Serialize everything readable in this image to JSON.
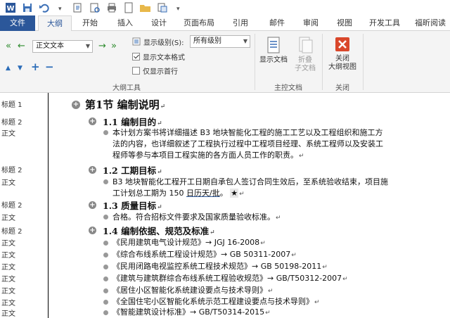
{
  "quick_access": {
    "icons": [
      "word-logo-icon",
      "save-icon",
      "undo-icon",
      "redo-icon",
      "open-icon",
      "print-preview-icon",
      "print-icon",
      "new-document-icon",
      "folder-icon",
      "format-icon"
    ]
  },
  "tabs": [
    "文件",
    "大纲",
    "开始",
    "插入",
    "设计",
    "页面布局",
    "引用",
    "邮件",
    "审阅",
    "视图",
    "开发工具",
    "福昕阅读"
  ],
  "ribbon": {
    "outline_tools": {
      "level_combo": "正文文本",
      "show_level_label": "显示级别(S):",
      "show_level_value": "所有级别",
      "show_text_format": "显示文本格式",
      "show_first_line": "仅显示首行",
      "group_label": "大纲工具"
    },
    "master_doc": {
      "show_doc": "显示文档",
      "collapse_sub_1": "折叠",
      "collapse_sub_2": "子文档",
      "group_label": "主控文档"
    },
    "close": {
      "close_1": "关闭",
      "close_2": "大纲视图",
      "group_label": "关闭"
    },
    "colors": {
      "close_red": "#d9472b",
      "accent": "#2b579a"
    }
  },
  "outline": {
    "styles": [
      "标题 1",
      "标题 2",
      "正文",
      "标题 2",
      "正文",
      "标题 2",
      "正文",
      "标题 2",
      "正文",
      "正文",
      "正文",
      "正文",
      "正文",
      "正文",
      "正文",
      "正文"
    ],
    "h1": "第1节 编制说明",
    "s1_title": "1.1 编制目的",
    "s1_body_1": "本计划方案书将详细描述 B3 地块智能化工程的施工工艺以及工程组织和施工方",
    "s1_body_2": "法的内容，也详细叙述了工程执行过程中工程项目经理、系统工程师以及安装工",
    "s1_body_3": "程师等参与本项目工程实施的各方面人员工作的职责。",
    "s2_title": "1.2 工期目标",
    "s2_body_1": "B3 地块智能化工程开工日期自承包人签订合同生效后，至系统验收结束，项目施",
    "s2_body_2a": "工计划总工期为 150 ",
    "s2_body_2b": "日历天/批",
    "s2_body_2c": "。",
    "s2_star": "★",
    "s3_title": "1.3 质量目标",
    "s3_body": "合格。符合招标文件要求及国家质量验收标准。",
    "s4_title": "1.4 编制依据、规范及标准",
    "refs": [
      "《民用建筑电气设计规范》→ JGJ 16-2008",
      "《综合布线系统工程设计规范》→ GB 50311-2007",
      "《民用闭路电视监控系统工程技术规范》→ GB 50198-2011",
      "《建筑与建筑群综合布线系统工程验收规范》→ GB/T50312-2007",
      "《居住小区智能化系统建设要点与技术导则》",
      "《全国住宅小区智能化系统示范工程建设要点与技术导则》",
      "《智能建筑设计标准》→ GB/T50314-2015"
    ],
    "pilcrow": "↵"
  }
}
